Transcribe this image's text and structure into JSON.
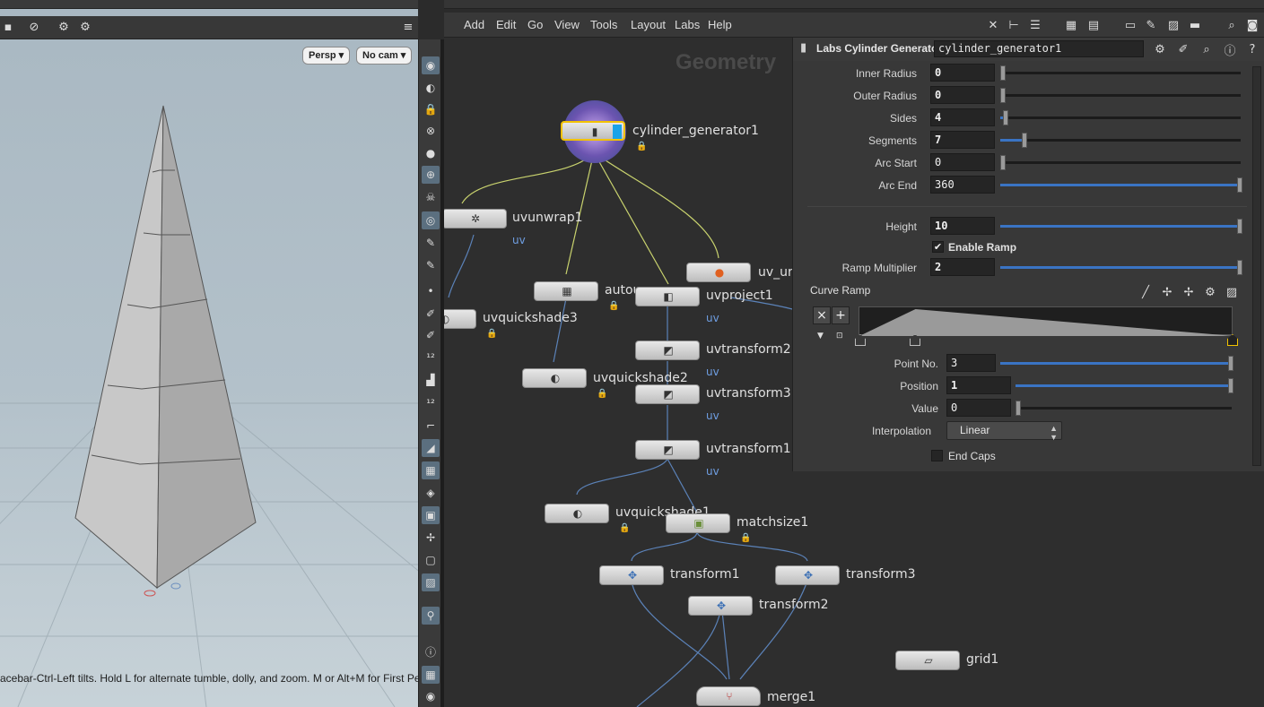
{
  "viewport": {
    "persp_label": "Persp",
    "cam_label": "No cam",
    "status_text": "acebar-Ctrl-Left tilts. Hold L for alternate tumble, dolly, and zoom. M or Alt+M for First Person"
  },
  "menubar": {
    "items": [
      "Add",
      "Edit",
      "Go",
      "View",
      "Tools",
      "Layout",
      "Labs",
      "Help"
    ]
  },
  "network": {
    "context_title": "Geometry",
    "uv_tag": "uv",
    "nodes": {
      "cylinder_generator1": "cylinder_generator1",
      "uvunwrap1": "uvunwrap1",
      "uv_ur": "uv_ur",
      "autouv": "autou",
      "uvproject1": "uvproject1",
      "uvquickshade3": "uvquickshade3",
      "uvtransform2": "uvtransform2",
      "uvquickshade2": "uvquickshade2",
      "uvtransform3": "uvtransform3",
      "uvtransform1": "uvtransform1",
      "uvquickshade1": "uvquickshade1",
      "matchsize1": "matchsize1",
      "transform1": "transform1",
      "transform3": "transform3",
      "transform2": "transform2",
      "grid1": "grid1",
      "merge1": "merge1"
    }
  },
  "params": {
    "op_type": "Labs Cylinder Generator",
    "op_name": "cylinder_generator1",
    "inner_radius": {
      "label": "Inner Radius",
      "value": "0",
      "fraction": 0.0
    },
    "outer_radius": {
      "label": "Outer Radius",
      "value": "0",
      "fraction": 0.0
    },
    "sides": {
      "label": "Sides",
      "value": "4",
      "fraction": 0.01
    },
    "segments": {
      "label": "Segments",
      "value": "7",
      "fraction": 0.09
    },
    "arc_start": {
      "label": "Arc Start",
      "value": "0",
      "fraction": 0.0
    },
    "arc_end": {
      "label": "Arc End",
      "value": "360",
      "fraction": 1.0
    },
    "height": {
      "label": "Height",
      "value": "10",
      "fraction": 1.0
    },
    "enable_ramp": {
      "label": "Enable Ramp",
      "checked": true
    },
    "ramp_multiplier": {
      "label": "Ramp Multiplier",
      "value": "2",
      "fraction": 1.0
    },
    "curve_ramp": {
      "label": "Curve Ramp",
      "points": [
        [
          0.0,
          0.0
        ],
        [
          0.15,
          1.0
        ],
        [
          1.0,
          0.0
        ]
      ]
    },
    "point_no": {
      "label": "Point No.",
      "value": "3",
      "fraction": 1.0
    },
    "position": {
      "label": "Position",
      "value": "1",
      "fraction": 1.0
    },
    "value": {
      "label": "Value",
      "value": "0",
      "fraction": 0.0
    },
    "interpolation": {
      "label": "Interpolation",
      "value": "Linear"
    },
    "end_caps": {
      "label": "End Caps",
      "checked": false
    }
  },
  "colors": {
    "accent_blue": "#3a74c4",
    "uv_tag": "#6f9ee2",
    "selected_node_outline": "#f2c200",
    "display_flag": "#1aa3e8"
  }
}
